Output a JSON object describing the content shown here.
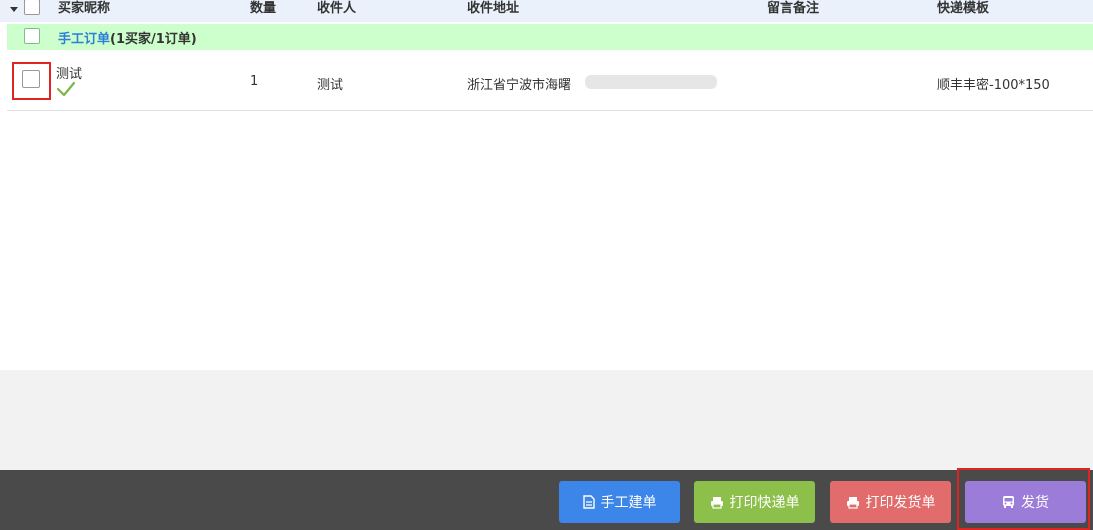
{
  "header": {
    "columns": {
      "buyer": "买家昵称",
      "qty": "数量",
      "recipient": "收件人",
      "address": "收件地址",
      "note": "留言备注",
      "template": "快递模板"
    }
  },
  "group": {
    "name": "手工订单",
    "summary": "(1买家/1订单)"
  },
  "order": {
    "buyer": "测试",
    "qty": "1",
    "recipient": "测试",
    "address": "浙江省宁波市海曙",
    "template": "顺丰丰密-100*150"
  },
  "actions": {
    "manual_order": "手工建单",
    "print_express": "打印快递单",
    "print_delivery": "打印发货单",
    "ship": "发货"
  },
  "colors": {
    "header_bg": "#eaf1fb",
    "group_bg": "#ccffcc",
    "accent_blue": "#2f7ed8",
    "check_green": "#7ab648",
    "btn_blue": "#3b86e8",
    "btn_green": "#8cc04b",
    "btn_red": "#e26b6b",
    "btn_purple": "#9b7dd9",
    "footer_bg": "#4a4a4a",
    "highlight_red": "#e02424"
  }
}
